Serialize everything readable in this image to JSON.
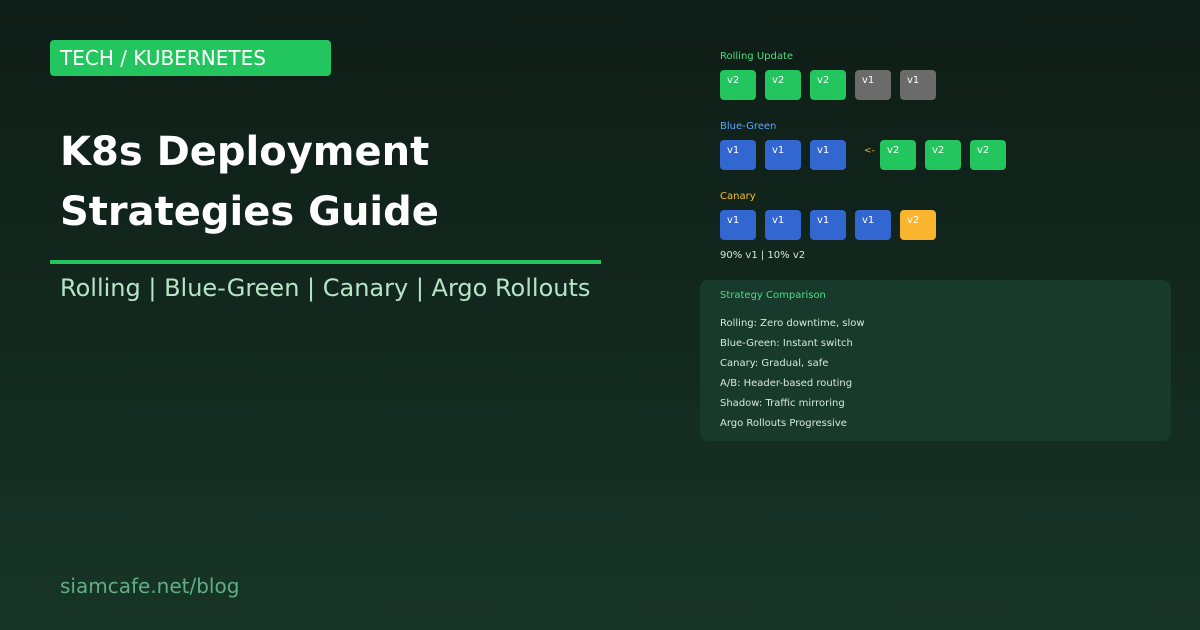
{
  "tag": "TECH / KUBERNETES",
  "title_lines": [
    "K8s Deployment",
    "Strategies Guide"
  ],
  "subtitle": "Rolling | Blue-Green | Canary | Argo Rollouts",
  "footer": "siamcafe.net/blog",
  "colors": {
    "accent": "#22c55e",
    "blue": "#3266d0",
    "gray": "#6b6b6b",
    "orange": "#fbb42d",
    "blue_label": "#60a5fa",
    "orange_label": "#fbbf24"
  },
  "rolling": {
    "label": "Rolling Update",
    "boxes": [
      "v2",
      "v2",
      "v2",
      "v1",
      "v1"
    ]
  },
  "bluegreen": {
    "label": "Blue-Green",
    "blue_boxes": [
      "v1",
      "v1",
      "v1"
    ],
    "arrow": "<-",
    "green_boxes": [
      "v2",
      "v2",
      "v2"
    ]
  },
  "canary": {
    "label": "Canary",
    "boxes": [
      "v1",
      "v1",
      "v1",
      "v1",
      "v2"
    ],
    "ratio": "90% v1 | 10% v2"
  },
  "comparison": {
    "title": "Strategy Comparison",
    "items": [
      "Rolling: Zero downtime, slow",
      "Blue-Green: Instant switch",
      "Canary: Gradual, safe",
      "A/B: Header-based routing",
      "Shadow: Traffic mirroring",
      "Argo Rollouts Progressive"
    ]
  }
}
